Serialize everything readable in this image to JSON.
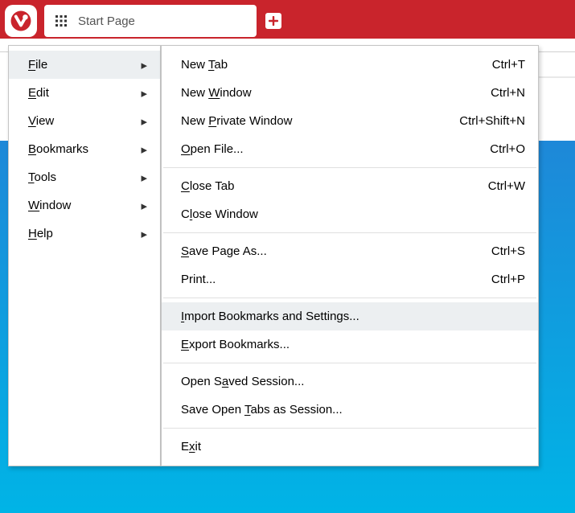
{
  "tab": {
    "title": "Start Page"
  },
  "main_menu": [
    {
      "key": "file",
      "label": "File",
      "ul": 0,
      "hover": true
    },
    {
      "key": "edit",
      "label": "Edit",
      "ul": 0,
      "hover": false
    },
    {
      "key": "view",
      "label": "View",
      "ul": 0,
      "hover": false
    },
    {
      "key": "bookmarks",
      "label": "Bookmarks",
      "ul": 0,
      "hover": false
    },
    {
      "key": "tools",
      "label": "Tools",
      "ul": 0,
      "hover": false
    },
    {
      "key": "window",
      "label": "Window",
      "ul": 0,
      "hover": false
    },
    {
      "key": "help",
      "label": "Help",
      "ul": 0,
      "hover": false
    }
  ],
  "file_menu": [
    {
      "type": "item",
      "key": "new-tab",
      "label": "New Tab",
      "ul": 4,
      "shortcut": "Ctrl+T"
    },
    {
      "type": "item",
      "key": "new-window",
      "label": "New Window",
      "ul": 4,
      "shortcut": "Ctrl+N"
    },
    {
      "type": "item",
      "key": "new-private",
      "label": "New Private Window",
      "ul": 4,
      "shortcut": "Ctrl+Shift+N"
    },
    {
      "type": "item",
      "key": "open-file",
      "label": "Open File...",
      "ul": 0,
      "shortcut": "Ctrl+O"
    },
    {
      "type": "sep"
    },
    {
      "type": "item",
      "key": "close-tab",
      "label": "Close Tab",
      "ul": 0,
      "shortcut": "Ctrl+W"
    },
    {
      "type": "item",
      "key": "close-window",
      "label": "Close Window",
      "ul": 1,
      "shortcut": ""
    },
    {
      "type": "sep"
    },
    {
      "type": "item",
      "key": "save-page-as",
      "label": "Save Page As...",
      "ul": 0,
      "shortcut": "Ctrl+S"
    },
    {
      "type": "item",
      "key": "print",
      "label": "Print...",
      "ul": -1,
      "shortcut": "Ctrl+P"
    },
    {
      "type": "sep"
    },
    {
      "type": "item",
      "key": "import",
      "label": "Import Bookmarks and Settings...",
      "ul": 0,
      "shortcut": "",
      "hover": true
    },
    {
      "type": "item",
      "key": "export",
      "label": "Export Bookmarks...",
      "ul": 0,
      "shortcut": ""
    },
    {
      "type": "sep"
    },
    {
      "type": "item",
      "key": "open-session",
      "label": "Open Saved Session...",
      "ul": 6,
      "shortcut": ""
    },
    {
      "type": "item",
      "key": "save-session",
      "label": "Save Open Tabs as Session...",
      "ul": 10,
      "shortcut": ""
    },
    {
      "type": "sep"
    },
    {
      "type": "item",
      "key": "exit",
      "label": "Exit",
      "ul": 1,
      "shortcut": ""
    }
  ]
}
